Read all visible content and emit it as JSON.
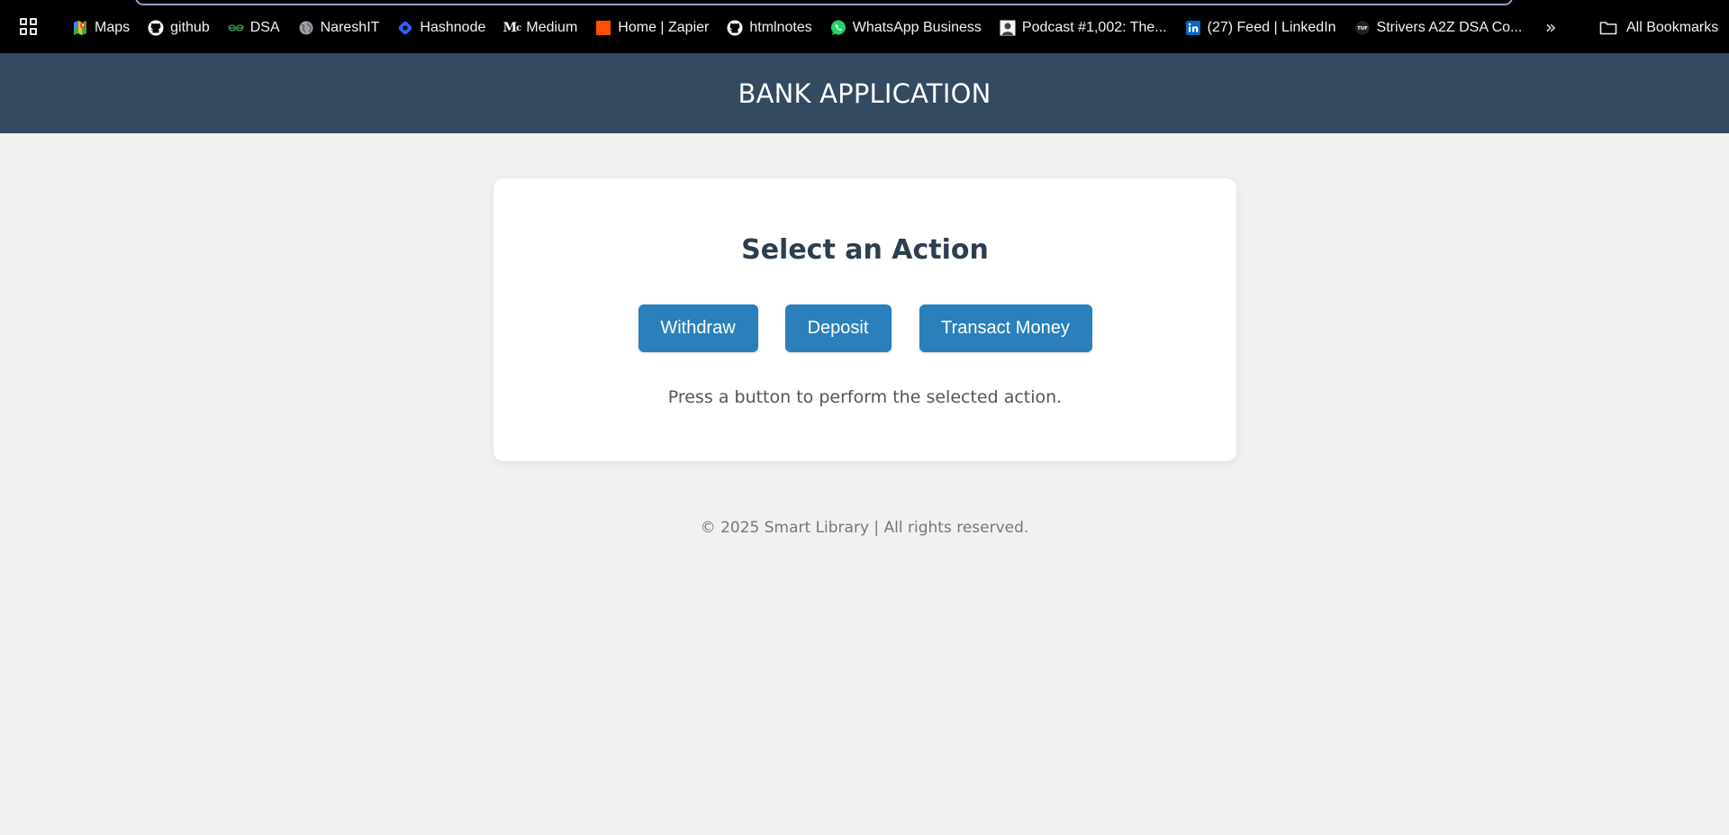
{
  "bookmarks_bar": {
    "apps_icon": "apps-grid-icon",
    "items": [
      {
        "label": "Maps",
        "icon": "google-maps-icon"
      },
      {
        "label": "github",
        "icon": "github-icon"
      },
      {
        "label": "DSA",
        "icon": "geeksforgeeks-icon"
      },
      {
        "label": "NareshIT",
        "icon": "globe-icon"
      },
      {
        "label": "Hashnode",
        "icon": "hashnode-icon"
      },
      {
        "label": "Medium",
        "icon": "medium-icon"
      },
      {
        "label": "Home | Zapier",
        "icon": "zapier-icon"
      },
      {
        "label": "htmlnotes",
        "icon": "github-icon"
      },
      {
        "label": "WhatsApp Business",
        "icon": "whatsapp-icon"
      },
      {
        "label": "Podcast #1,002: The...",
        "icon": "podcast-avatar-icon"
      },
      {
        "label": "(27) Feed | LinkedIn",
        "icon": "linkedin-icon"
      },
      {
        "label": "Strivers A2Z DSA Co...",
        "icon": "tuf-icon"
      }
    ],
    "more_icon": "double-chevron-right-icon",
    "more_glyph": "»",
    "all_bookmarks_label": "All Bookmarks",
    "all_bookmarks_icon": "folder-icon"
  },
  "header": {
    "title": "BANK APPLICATION"
  },
  "card": {
    "title": "Select an Action",
    "buttons": {
      "withdraw": "Withdraw",
      "deposit": "Deposit",
      "transact": "Transact Money"
    },
    "message": "Press a button to perform the selected action."
  },
  "footer": {
    "text": "© 2025 Smart Library | All rights reserved."
  },
  "colors": {
    "header_bg": "#344a60",
    "page_bg": "#f1f1f1",
    "button_bg": "#2b80bb",
    "title_text": "#2c3e50",
    "bookmarks_bg": "#000000"
  }
}
